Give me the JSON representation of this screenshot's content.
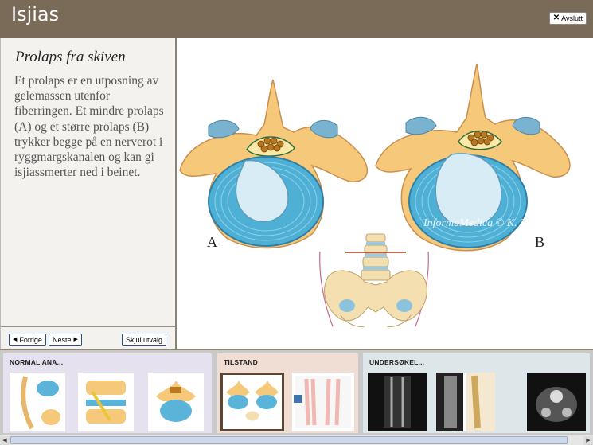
{
  "header": {
    "title": "Isjias",
    "exit_label": "Avslutt"
  },
  "sidebar": {
    "heading": "Prolaps fra skiven",
    "body": "Et prolaps er en utposning av gelemassen utenfor fiberringen. Et mindre prolaps (A) og et større prolaps (B) trykker begge på en nerverot i ryggmargskanalen og kan gi isjiassmerter ned i beinet.",
    "prev_label": "Forrige",
    "next_label": "Neste",
    "hide_label": "Skjul utvalg"
  },
  "image": {
    "label_a": "A",
    "label_b": "B",
    "watermark": "InformaMedica © K. Toverud"
  },
  "gallery": {
    "sections": [
      {
        "label": "NORMAL ANA..."
      },
      {
        "label": "TILSTAND"
      },
      {
        "label": "UNDERSØKEL..."
      }
    ]
  },
  "colors": {
    "header_bg": "#7a6a58",
    "sidebar_bg": "#f3f2ef",
    "section1_bg": "#e5e1ee",
    "section2_bg": "#f0ddd4",
    "section3_bg": "#dde6e8",
    "selected_border": "#5a4632"
  }
}
